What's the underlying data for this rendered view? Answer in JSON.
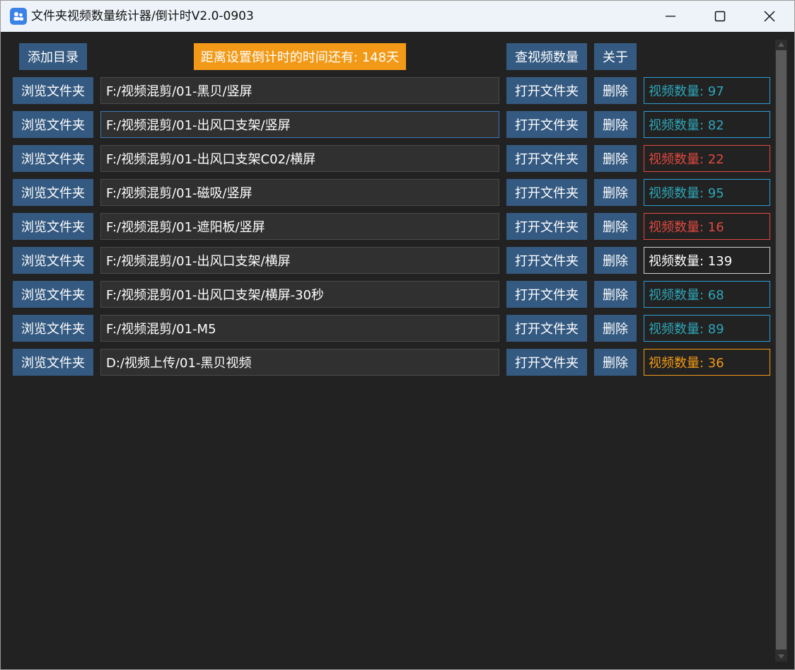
{
  "window": {
    "title": "文件夹视频数量统计器/倒计时V2.0-0903"
  },
  "toolbar": {
    "add_dir_label": "添加目录",
    "countdown_text": "距离设置倒计时的时间还有: 148天",
    "check_count_label": "查视频数量",
    "about_label": "关于"
  },
  "colors": {
    "button_bg": "#355a81",
    "countdown_bg": "#f29a17",
    "count_teal": "#2ea6b8",
    "count_red": "#e0483f",
    "count_white": "#ffffff",
    "count_orange": "#f29a17"
  },
  "icons": [
    "app-icon",
    "minimize-icon",
    "maximize-icon",
    "close-icon",
    "scroll-up-icon",
    "scroll-down-icon"
  ],
  "rows": [
    {
      "browse_label": "浏览文件夹",
      "path": "F:/视频混剪/01-黑贝/竖屏",
      "open_label": "打开文件夹",
      "delete_label": "删除",
      "count_text": "视频数量: 97",
      "count_color": "#2ea6b8",
      "border_color": "#2e9bd2"
    },
    {
      "browse_label": "浏览文件夹",
      "path": "F:/视频混剪/01-出风口支架/竖屏",
      "open_label": "打开文件夹",
      "delete_label": "删除",
      "count_text": "视频数量: 82",
      "count_color": "#2ea6b8",
      "border_color": "#2e9bd2"
    },
    {
      "browse_label": "浏览文件夹",
      "path": "F:/视频混剪/01-出风口支架C02/横屏",
      "open_label": "打开文件夹",
      "delete_label": "删除",
      "count_text": "视频数量: 22",
      "count_color": "#e0483f",
      "border_color": "#e0483f"
    },
    {
      "browse_label": "浏览文件夹",
      "path": "F:/视频混剪/01-磁吸/竖屏",
      "open_label": "打开文件夹",
      "delete_label": "删除",
      "count_text": "视频数量: 95",
      "count_color": "#2ea6b8",
      "border_color": "#2e9bd2"
    },
    {
      "browse_label": "浏览文件夹",
      "path": "F:/视频混剪/01-遮阳板/竖屏",
      "open_label": "打开文件夹",
      "delete_label": "删除",
      "count_text": "视频数量: 16",
      "count_color": "#e0483f",
      "border_color": "#e0483f"
    },
    {
      "browse_label": "浏览文件夹",
      "path": "F:/视频混剪/01-出风口支架/横屏",
      "open_label": "打开文件夹",
      "delete_label": "删除",
      "count_text": "视频数量: 139",
      "count_color": "#ffffff",
      "border_color": "#cfcfcf"
    },
    {
      "browse_label": "浏览文件夹",
      "path": "F:/视频混剪/01-出风口支架/横屏-30秒",
      "open_label": "打开文件夹",
      "delete_label": "删除",
      "count_text": "视频数量: 68",
      "count_color": "#2ea6b8",
      "border_color": "#2e9bd2"
    },
    {
      "browse_label": "浏览文件夹",
      "path": "F:/视频混剪/01-M5",
      "open_label": "打开文件夹",
      "delete_label": "删除",
      "count_text": "视频数量: 89",
      "count_color": "#2ea6b8",
      "border_color": "#2e9bd2"
    },
    {
      "browse_label": "浏览文件夹",
      "path": "D:/视频上传/01-黑贝视频",
      "open_label": "打开文件夹",
      "delete_label": "删除",
      "count_text": "视频数量: 36",
      "count_color": "#f29a17",
      "border_color": "#f29a17"
    }
  ]
}
